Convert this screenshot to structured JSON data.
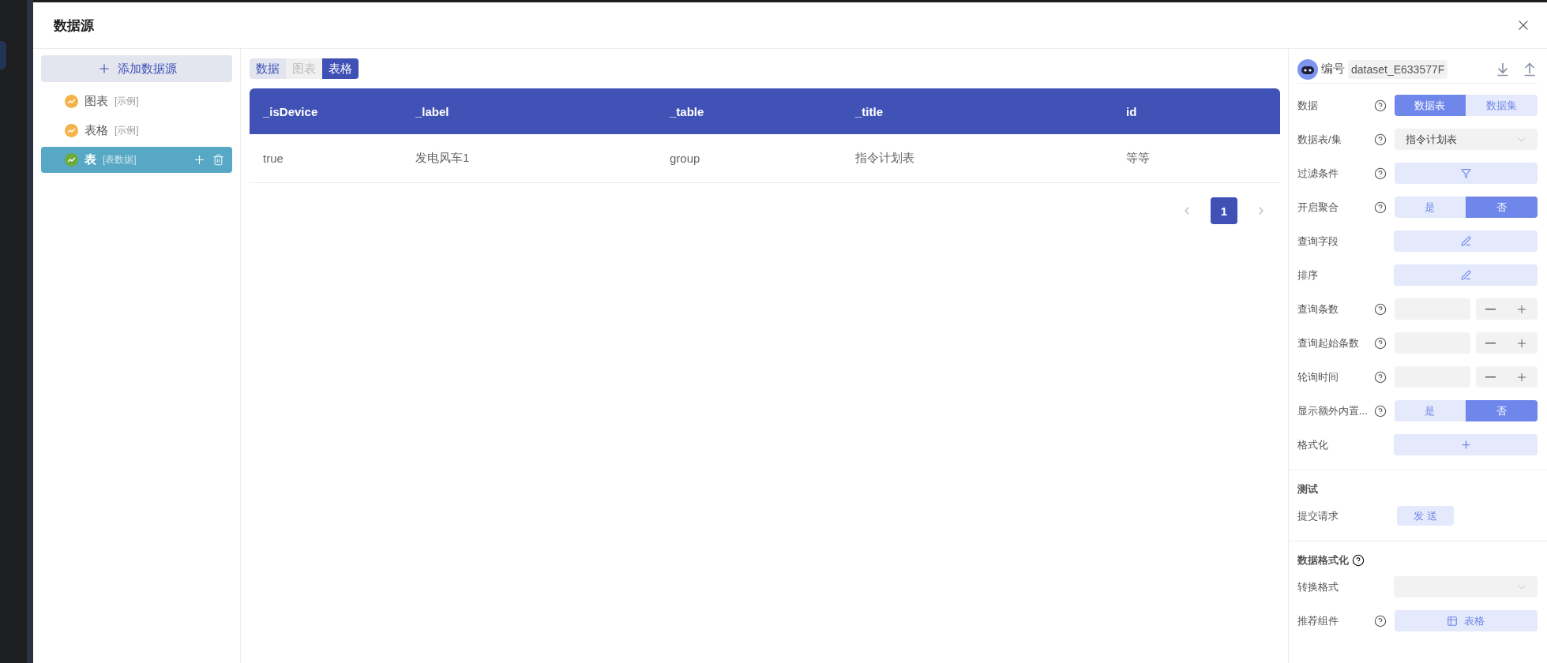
{
  "dialog": {
    "title": "数据源"
  },
  "sources": {
    "add_button": "添加数据源",
    "items": [
      {
        "name": "图表",
        "tag": "[示例]",
        "kind": "example",
        "selected": false
      },
      {
        "name": "表格",
        "tag": "[示例]",
        "kind": "example",
        "selected": false
      },
      {
        "name": "表",
        "tag": "[表数据]",
        "kind": "table",
        "selected": true
      }
    ]
  },
  "view_tabs": [
    {
      "label": "数据",
      "selected": false,
      "disabled": false
    },
    {
      "label": "图表",
      "selected": false,
      "disabled": true
    },
    {
      "label": "表格",
      "selected": true,
      "disabled": false
    }
  ],
  "table": {
    "columns": [
      "_isDevice",
      "_label",
      "_table",
      "_title",
      "id"
    ],
    "rows": [
      [
        "true",
        "发电风车1",
        "group",
        "指令计划表",
        "等等"
      ]
    ]
  },
  "pagination": {
    "pages": [
      {
        "label": "1",
        "selected": true
      }
    ]
  },
  "settings": {
    "id_label": "编号",
    "id_value": "dataset_E633577F",
    "rows": [
      {
        "label": "数据",
        "help": true,
        "kind": "segmented",
        "options": [
          {
            "label": "数据表",
            "selected": true
          },
          {
            "label": "数据集",
            "selected": false
          }
        ]
      },
      {
        "label": "数据表/集",
        "help": true,
        "kind": "select",
        "value": "指令计划表"
      },
      {
        "label": "过滤条件",
        "help": true,
        "kind": "filter"
      },
      {
        "label": "开启聚合",
        "help": true,
        "kind": "segmented",
        "options": [
          {
            "label": "是",
            "selected": false
          },
          {
            "label": "否",
            "selected": true
          }
        ]
      },
      {
        "label": "查询字段",
        "help": false,
        "kind": "edit"
      },
      {
        "label": "排序",
        "help": false,
        "kind": "edit"
      },
      {
        "label": "查询条数",
        "help": true,
        "kind": "number"
      },
      {
        "label": "查询起始条数",
        "help": true,
        "kind": "number"
      },
      {
        "label": "轮询时间",
        "help": true,
        "kind": "number"
      },
      {
        "label": "显示额外内置...",
        "help": true,
        "kind": "segmented",
        "options": [
          {
            "label": "是",
            "selected": false
          },
          {
            "label": "否",
            "selected": true
          }
        ]
      },
      {
        "label": "格式化",
        "help": false,
        "kind": "add"
      }
    ]
  },
  "test": {
    "title": "测试",
    "label": "提交请求",
    "button": "发 送"
  },
  "format": {
    "title": "数据格式化",
    "help": true,
    "rows": [
      {
        "label": "转换格式",
        "help": false,
        "kind": "select"
      },
      {
        "label": "推荐组件",
        "help": true,
        "kind": "component",
        "value": "表格"
      }
    ]
  }
}
